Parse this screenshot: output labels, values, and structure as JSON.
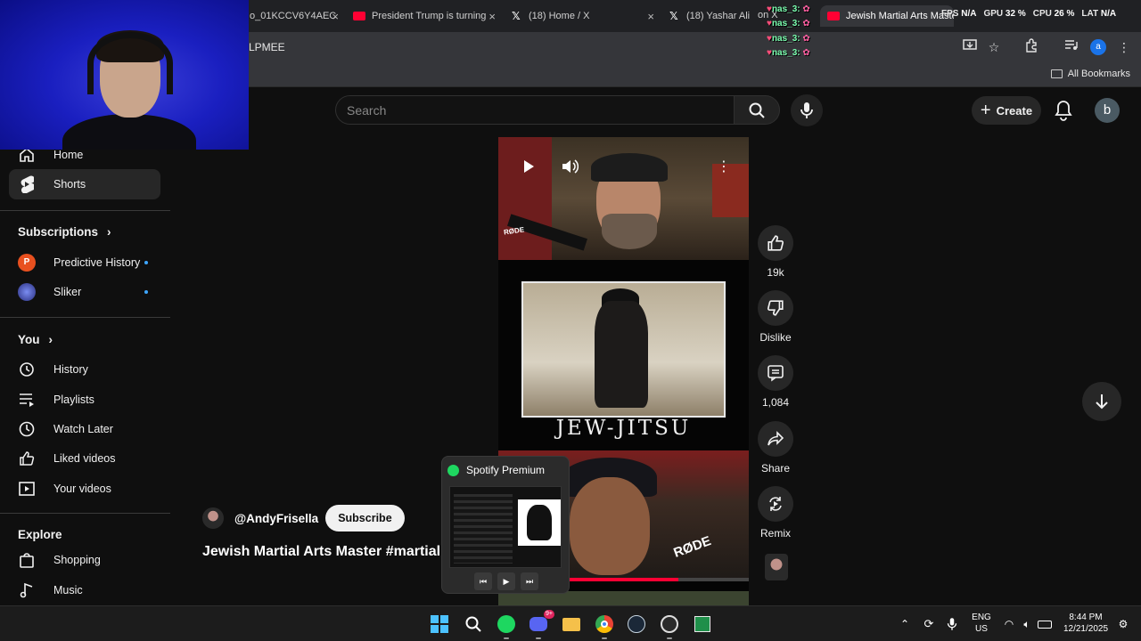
{
  "browser": {
    "tabs": [
      {
        "label": "o_01KCCV6Y4AEC",
        "icon": "generic-icon"
      },
      {
        "label": "President Trump is turning",
        "icon": "youtube-icon"
      },
      {
        "label": "(18) Home / X",
        "icon": "x-icon"
      },
      {
        "label": "(18) Yashar Ali",
        "icon": "x-icon"
      },
      {
        "label": "Jewish Martial Arts Maste",
        "icon": "youtube-icon"
      }
    ],
    "address_text": "LPMEE",
    "bookmarks_label": "All Bookmarks",
    "tab_close": "×",
    "account_letter": "a"
  },
  "overlay": {
    "chat_user": "nas_3:",
    "chat_lines": 4,
    "stats": [
      {
        "label": "FPS",
        "value": "N/A"
      },
      {
        "label": "GPU",
        "value": "32 %"
      },
      {
        "label": "CPU",
        "value": "26 %"
      },
      {
        "label": "LAT",
        "value": "N/A"
      }
    ],
    "inline_fragment": "on X"
  },
  "youtube": {
    "search_placeholder": "Search",
    "create_label": "Create",
    "avatar_letter": "b",
    "sidebar": {
      "home": "Home",
      "shorts": "Shorts",
      "subscriptions_header": "Subscriptions",
      "channels": [
        {
          "name": "Predictive History",
          "initial": "P",
          "color": "#e8501f"
        },
        {
          "name": "Sliker",
          "initial": "",
          "color": "#3a4aa6"
        }
      ],
      "you_header": "You",
      "you_items": [
        "History",
        "Playlists",
        "Watch Later",
        "Liked videos",
        "Your videos"
      ],
      "explore_header": "Explore",
      "explore_items": [
        "Shopping",
        "Music"
      ]
    },
    "short": {
      "poster_caption": "JEW-JITSU",
      "mic_text": "RØDE",
      "mic_text_2": "RØDE",
      "progress_fraction": 0.72,
      "channel": "@AndyFrisella",
      "subscribe_label": "Subscribe",
      "title": "Jewish Martial Arts Master #martial"
    },
    "actions": {
      "likes": "19k",
      "dislike": "Dislike",
      "comments": "1,084",
      "share": "Share",
      "remix": "Remix"
    }
  },
  "spotify_popup": {
    "title": "Spotify Premium"
  },
  "taskbar": {
    "discord_badge": "9+",
    "language": "ENG",
    "region": "US",
    "time": "8:44 PM",
    "date": "12/21/2025"
  },
  "colors": {
    "youtube_red": "#ff0033",
    "spotify_green": "#1ed760",
    "link_blue": "#3ea6ff"
  }
}
